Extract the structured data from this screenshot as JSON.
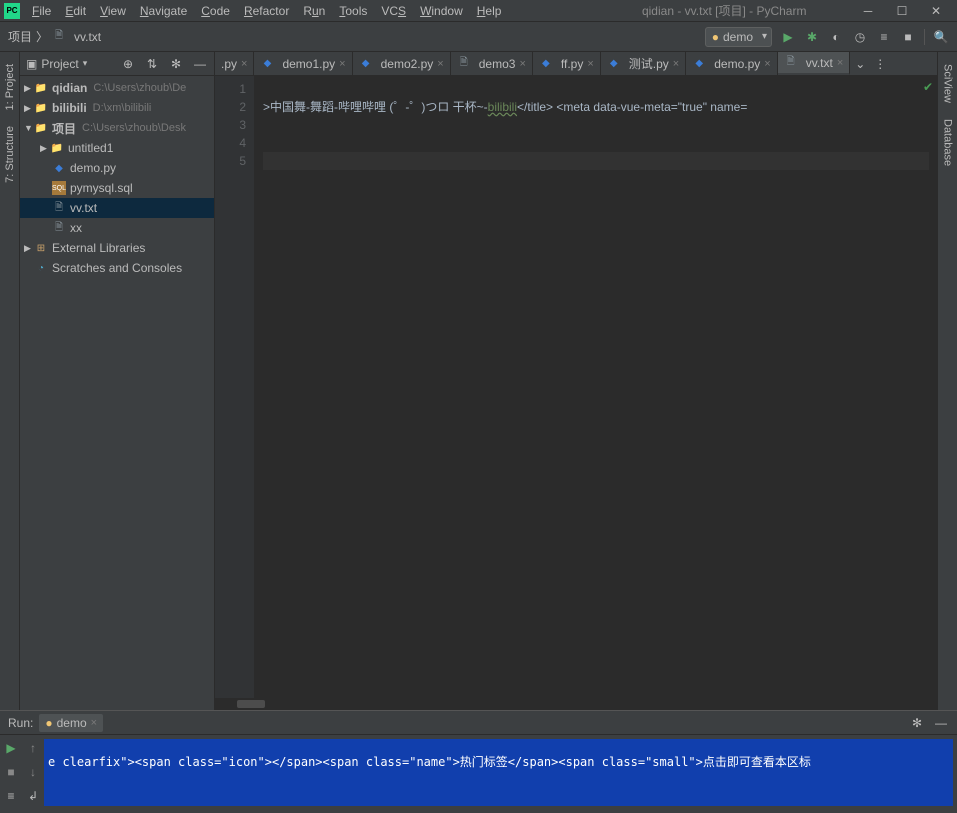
{
  "window": {
    "title": "qidian - vv.txt [项目] - PyCharm",
    "menu": [
      "File",
      "Edit",
      "View",
      "Navigate",
      "Code",
      "Refactor",
      "Run",
      "Tools",
      "VCS",
      "Window",
      "Help"
    ]
  },
  "breadcrumb": {
    "root": "项目",
    "file": "vv.txt"
  },
  "run_config": {
    "label": "demo"
  },
  "project_panel": {
    "title": "Project"
  },
  "tree": {
    "qidian": {
      "name": "qidian",
      "path": "C:\\Users\\zhoub\\De"
    },
    "bilibili": {
      "name": "bilibili",
      "path": "D:\\xm\\bilibili"
    },
    "proj": {
      "name": "项目",
      "path": "C:\\Users\\zhoub\\Desk"
    },
    "untitled1": "untitled1",
    "demopy": "demo.py",
    "pymysql": "pymysql.sql",
    "vvtxt": "vv.txt",
    "xx": "xx",
    "ext": "External Libraries",
    "scratch": "Scratches and Consoles"
  },
  "tabs": [
    {
      "label": ".py",
      "icon": "py"
    },
    {
      "label": "demo1.py",
      "icon": "py"
    },
    {
      "label": "demo2.py",
      "icon": "py"
    },
    {
      "label": "demo3",
      "icon": "file"
    },
    {
      "label": "ff.py",
      "icon": "py"
    },
    {
      "label": "测试.py",
      "icon": "py"
    },
    {
      "label": "demo.py",
      "icon": "py"
    },
    {
      "label": "vv.txt",
      "icon": "file",
      "active": true
    }
  ],
  "editor": {
    "lines": [
      "1",
      "2",
      "3",
      "4",
      "5"
    ],
    "line2_pre": ">中国舞-舞蹈-哔哩哔哩 (゜-゜)つロ 干杯~-",
    "line2_green": "bilibili",
    "line2_post": "</title> <meta data-vue-meta=\"true\" name="
  },
  "rails": {
    "project": "1: Project",
    "structure": "7: Structure",
    "sciview": "SciView",
    "database": "Database"
  },
  "run": {
    "label": "Run:",
    "tab": "demo",
    "output": "e clearfix\"><span class=\"icon\"></span><span class=\"name\">热门标签</span><span class=\"small\">点击即可查看本区标"
  }
}
